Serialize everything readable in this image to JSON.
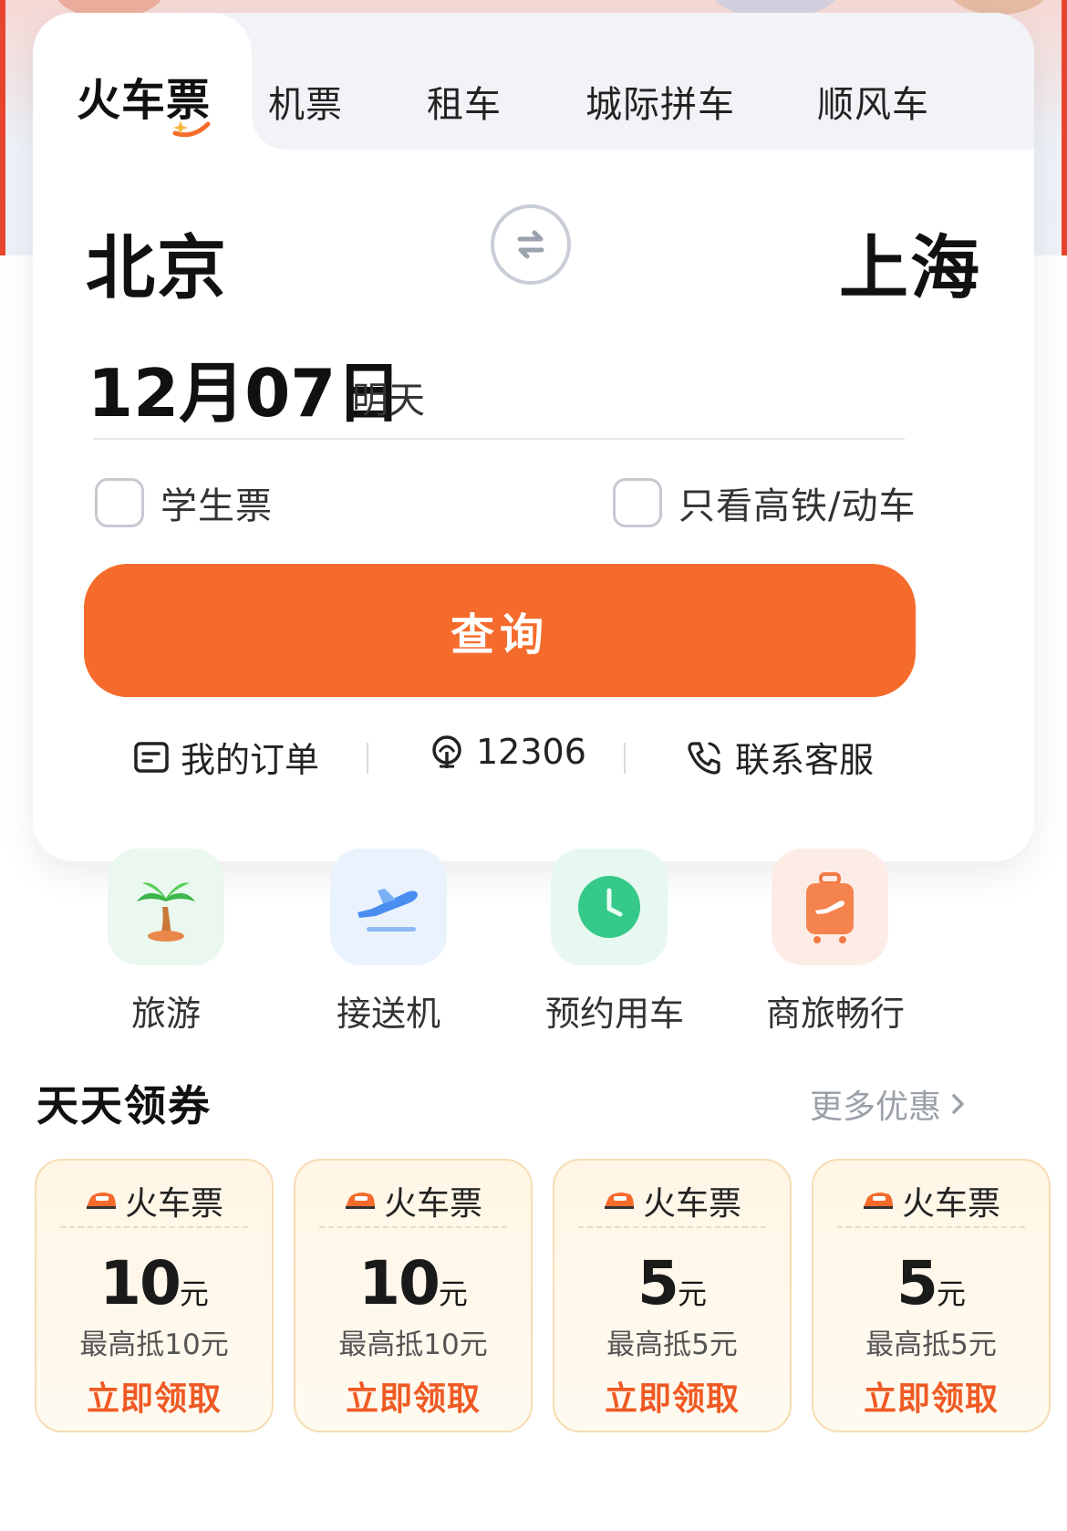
{
  "tabs": {
    "active": "火车票",
    "items": [
      "机票",
      "租车",
      "城际拼车",
      "顺风车"
    ]
  },
  "route": {
    "from": "北京",
    "to": "上海"
  },
  "date": {
    "value": "12月07日",
    "relative": "明天"
  },
  "options": {
    "student": "学生票",
    "high_speed_only": "只看高铁/动车"
  },
  "search_button": "查询",
  "links": {
    "orders": "我的订单",
    "rail": "12306",
    "service": "联系客服"
  },
  "quick": [
    {
      "label": "旅游",
      "icon": "palm-tree-icon"
    },
    {
      "label": "接送机",
      "icon": "airplane-icon"
    },
    {
      "label": "预约用车",
      "icon": "clock-icon"
    },
    {
      "label": "商旅畅行",
      "icon": "suitcase-icon"
    }
  ],
  "coupons_section": {
    "title": "天天领券",
    "more": "更多优惠"
  },
  "coupons": [
    {
      "type": "火车票",
      "amount": "10",
      "unit": "元",
      "desc": "最高抵10元",
      "cta": "立即领取"
    },
    {
      "type": "火车票",
      "amount": "10",
      "unit": "元",
      "desc": "最高抵10元",
      "cta": "立即领取"
    },
    {
      "type": "火车票",
      "amount": "5",
      "unit": "元",
      "desc": "最高抵5元",
      "cta": "立即领取"
    },
    {
      "type": "火车票",
      "amount": "5",
      "unit": "元",
      "desc": "最高抵5元",
      "cta": "立即领取"
    }
  ],
  "colors": {
    "accent": "#f46b2b",
    "cta_text": "#ef5a24",
    "coupon_bg": "#fff6e6"
  }
}
